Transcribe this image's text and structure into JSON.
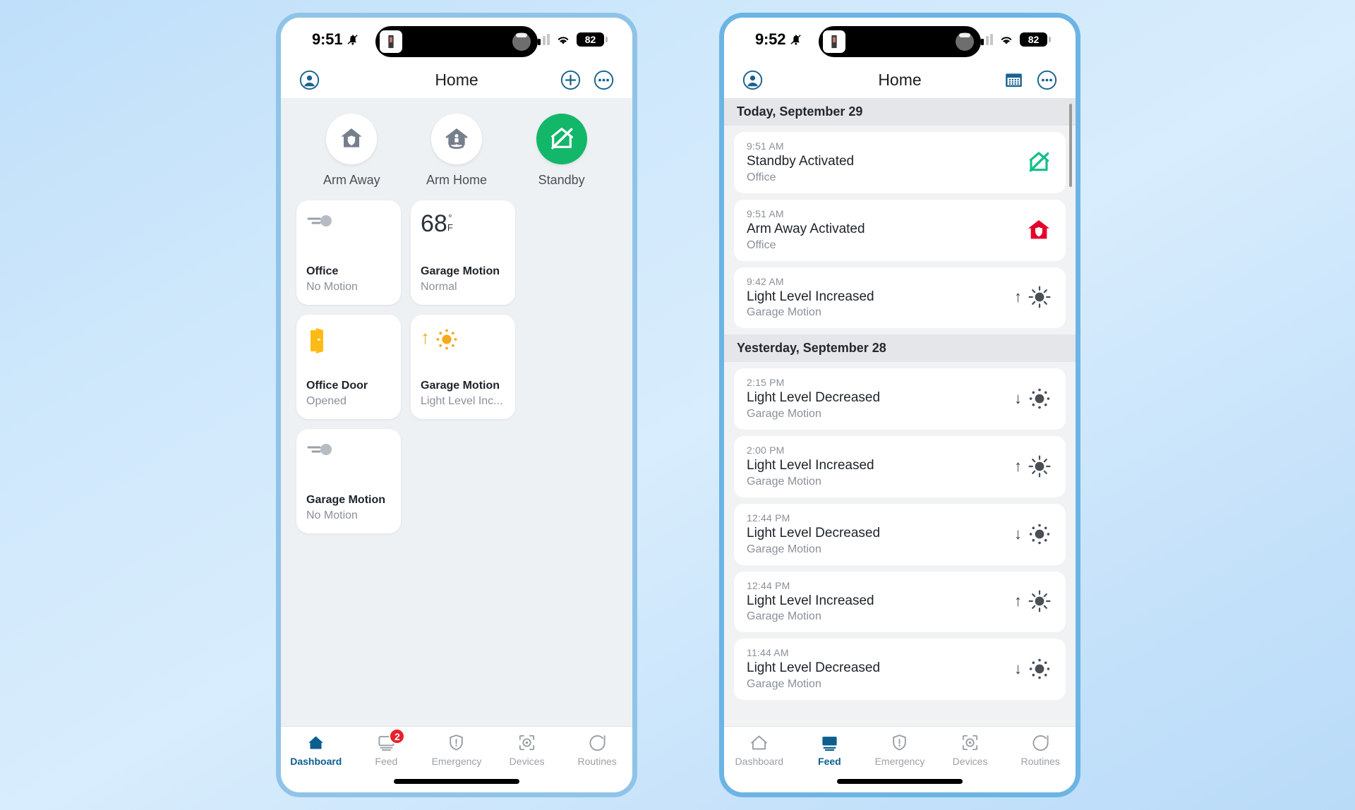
{
  "theme": {
    "accent": "#0b5e8e",
    "active_green": "#12b76a",
    "alert_red": "#e8202a",
    "door_amber": "#febb15",
    "muted_gray": "#8a9099",
    "background_blue": "#cfe8fb"
  },
  "left_phone": {
    "status_bar": {
      "time": "9:51",
      "bell_icon": "bell-slash-icon",
      "signal_icon": "cellular-bars-icon",
      "wifi_icon": "wifi-icon",
      "battery_level": "82"
    },
    "nav": {
      "title": "Home",
      "profile_icon": "person-circle-icon",
      "add_icon": "plus-circle-icon",
      "more_icon": "more-circle-icon"
    },
    "modes": [
      {
        "label": "Arm Away",
        "icon": "house-shield-icon",
        "active": false
      },
      {
        "label": "Arm Home",
        "icon": "house-person-icon",
        "active": false
      },
      {
        "label": "Standby",
        "icon": "house-slash-icon",
        "active": true
      }
    ],
    "cards": [
      {
        "name": "Office",
        "status": "No Motion",
        "icon": "motion-sensor-icon"
      },
      {
        "name": "Garage Motion",
        "status": "Normal",
        "icon": "temperature-value",
        "value": "68",
        "degree": "°",
        "unit": "F"
      },
      {
        "name": "Office Door",
        "status": "Opened",
        "icon": "open-door-icon"
      },
      {
        "name": "Garage Motion",
        "status": "Light Level Inc...",
        "icon": "light-up-icon"
      },
      {
        "name": "Garage Motion",
        "status": "No Motion",
        "icon": "motion-sensor-icon"
      }
    ],
    "tabs": [
      {
        "label": "Dashboard",
        "icon": "home-icon",
        "active": true,
        "badge": null
      },
      {
        "label": "Feed",
        "icon": "monitor-icon",
        "active": false,
        "badge": "2"
      },
      {
        "label": "Emergency",
        "icon": "shield-alert-icon",
        "active": false,
        "badge": null
      },
      {
        "label": "Devices",
        "icon": "sensor-icon",
        "active": false,
        "badge": null
      },
      {
        "label": "Routines",
        "icon": "routine-icon",
        "active": false,
        "badge": null
      }
    ]
  },
  "right_phone": {
    "status_bar": {
      "time": "9:52",
      "bell_icon": "bell-slash-icon",
      "signal_icon": "cellular-bars-icon",
      "wifi_icon": "wifi-icon",
      "battery_level": "82"
    },
    "nav": {
      "title": "Home",
      "profile_icon": "person-circle-icon",
      "calendar_icon": "calendar-icon",
      "more_icon": "more-circle-icon"
    },
    "feed": [
      {
        "section": "Today, September 29",
        "items": [
          {
            "time": "9:51 AM",
            "title": "Standby Activated",
            "source": "Office",
            "icon": "house-slash-icon",
            "arrow": ""
          },
          {
            "time": "9:51 AM",
            "title": "Arm Away Activated",
            "source": "Office",
            "icon": "house-shield-icon",
            "arrow": ""
          },
          {
            "time": "9:42 AM",
            "title": "Light Level Increased",
            "source": "Garage Motion",
            "icon": "sun-solid-icon",
            "arrow": "↑"
          }
        ]
      },
      {
        "section": "Yesterday, September 28",
        "items": [
          {
            "time": "2:15 PM",
            "title": "Light Level Decreased",
            "source": "Garage Motion",
            "icon": "sun-dotted-icon",
            "arrow": "↓"
          },
          {
            "time": "2:00 PM",
            "title": "Light Level Increased",
            "source": "Garage Motion",
            "icon": "sun-solid-icon",
            "arrow": "↑"
          },
          {
            "time": "12:44 PM",
            "title": "Light Level Decreased",
            "source": "Garage Motion",
            "icon": "sun-dotted-icon",
            "arrow": "↓"
          },
          {
            "time": "12:44 PM",
            "title": "Light Level Increased",
            "source": "Garage Motion",
            "icon": "sun-solid-icon",
            "arrow": "↑"
          },
          {
            "time": "11:44 AM",
            "title": "Light Level Decreased",
            "source": "Garage Motion",
            "icon": "sun-dotted-icon",
            "arrow": "↓"
          }
        ]
      }
    ],
    "tabs": [
      {
        "label": "Dashboard",
        "icon": "home-icon",
        "active": false,
        "badge": null
      },
      {
        "label": "Feed",
        "icon": "monitor-icon",
        "active": true,
        "badge": null
      },
      {
        "label": "Emergency",
        "icon": "shield-alert-icon",
        "active": false,
        "badge": null
      },
      {
        "label": "Devices",
        "icon": "sensor-icon",
        "active": false,
        "badge": null
      },
      {
        "label": "Routines",
        "icon": "routine-icon",
        "active": false,
        "badge": null
      }
    ]
  }
}
